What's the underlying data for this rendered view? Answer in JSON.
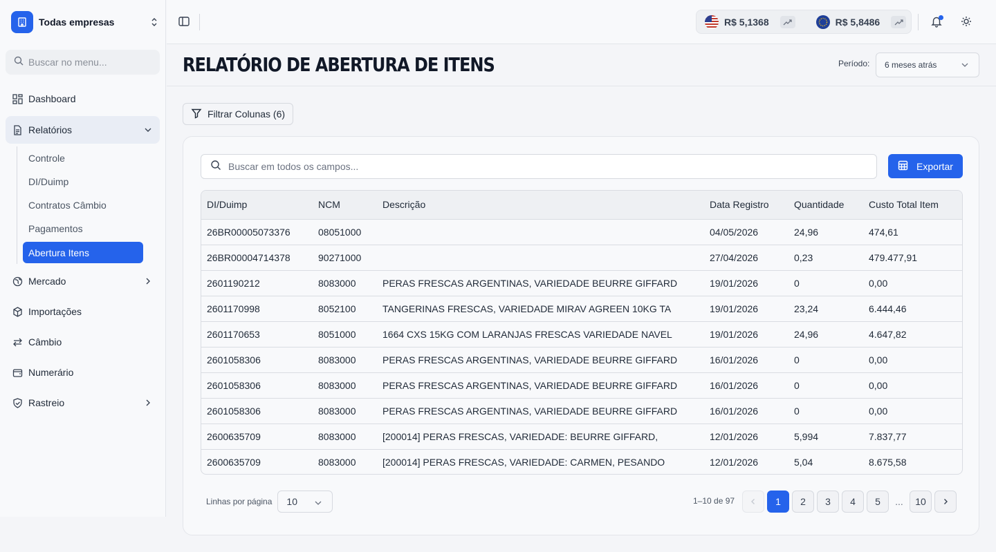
{
  "sidebar": {
    "company_name": "Todas empresas",
    "search_placeholder": "Buscar no menu...",
    "items": [
      {
        "label": "Dashboard"
      },
      {
        "label": "Relatórios"
      },
      {
        "label": "Mercado"
      },
      {
        "label": "Importações"
      },
      {
        "label": "Câmbio"
      },
      {
        "label": "Numerário"
      },
      {
        "label": "Rastreio"
      }
    ],
    "sub_items": [
      {
        "label": "Controle"
      },
      {
        "label": "DI/Duimp"
      },
      {
        "label": "Contratos Câmbio"
      },
      {
        "label": "Pagamentos"
      },
      {
        "label": "Abertura Itens"
      }
    ],
    "accent": "#2563eb"
  },
  "header": {
    "usd_rate": "R$ 5,1368",
    "eur_rate": "R$ 5,8486"
  },
  "page": {
    "title": "RELATÓRIO DE ABERTURA DE ITENS",
    "period_label": "Período:",
    "period_value": "6 meses atrás",
    "filter_label": "Filtrar Colunas (6)",
    "search_placeholder": "Buscar em todos os campos...",
    "export_label": "Exportar"
  },
  "table": {
    "columns": [
      "DI/Duimp",
      "NCM",
      "Descrição",
      "Data Registro",
      "Quantidade",
      "Custo Total Item"
    ],
    "rows": [
      [
        "26BR00005073376",
        "08051000",
        "",
        "04/05/2026",
        "24,96",
        "474,61"
      ],
      [
        "26BR00004714378",
        "90271000",
        "",
        "27/04/2026",
        "0,23",
        "479.477,91"
      ],
      [
        "2601190212",
        "8083000",
        "PERAS FRESCAS ARGENTINAS, VARIEDADE BEURRE GIFFARD",
        "19/01/2026",
        "0",
        "0,00"
      ],
      [
        "2601170998",
        "8052100",
        "TANGERINAS FRESCAS, VARIEDADE MIRAV AGREEN 10KG TA",
        "19/01/2026",
        "23,24",
        "6.444,46"
      ],
      [
        "2601170653",
        "8051000",
        "1664 CXS 15KG COM LARANJAS FRESCAS VARIEDADE NAVEL",
        "19/01/2026",
        "24,96",
        "4.647,82"
      ],
      [
        "2601058306",
        "8083000",
        "PERAS FRESCAS ARGENTINAS, VARIEDADE BEURRE GIFFARD",
        "16/01/2026",
        "0",
        "0,00"
      ],
      [
        "2601058306",
        "8083000",
        "PERAS FRESCAS ARGENTINAS, VARIEDADE BEURRE GIFFARD",
        "16/01/2026",
        "0",
        "0,00"
      ],
      [
        "2601058306",
        "8083000",
        "PERAS FRESCAS ARGENTINAS, VARIEDADE BEURRE GIFFARD",
        "16/01/2026",
        "0",
        "0,00"
      ],
      [
        "2600635709",
        "8083000",
        "[200014] PERAS FRESCAS, VARIEDADE: BEURRE GIFFARD,",
        "12/01/2026",
        "5,994",
        "7.837,77"
      ],
      [
        "2600635709",
        "8083000",
        "[200014] PERAS FRESCAS, VARIEDADE: CARMEN, PESANDO",
        "12/01/2026",
        "5,04",
        "8.675,58"
      ]
    ]
  },
  "pagination": {
    "rows_label": "Linhas por página",
    "rows_value": "10",
    "range": "1–10 de 97",
    "pages": [
      "1",
      "2",
      "3",
      "4",
      "5"
    ],
    "ellipsis": "...",
    "last_page": "10"
  }
}
